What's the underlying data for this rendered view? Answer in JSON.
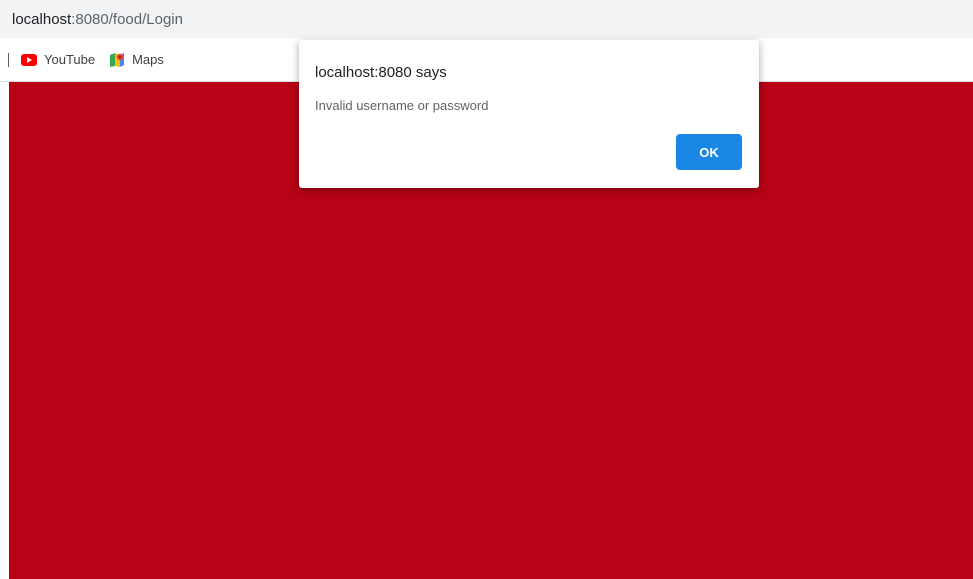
{
  "browser": {
    "url_host": "localhost",
    "url_path": ":8080/food/Login",
    "bookmarks": [
      {
        "label": "YouTube",
        "icon": "youtube-icon"
      },
      {
        "label": "Maps",
        "icon": "maps-icon"
      }
    ]
  },
  "page": {
    "background_color": "#b70315"
  },
  "dialog": {
    "title": "localhost:8080 says",
    "message": "Invalid username or password",
    "ok_label": "OK",
    "ok_color": "#1a87e6"
  }
}
